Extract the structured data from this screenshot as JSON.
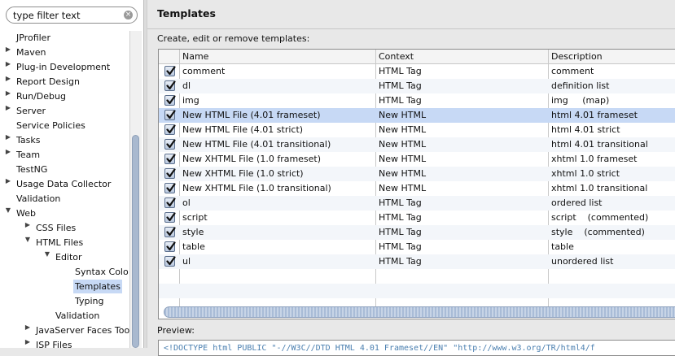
{
  "filter": {
    "placeholder": "type filter text"
  },
  "tree": [
    {
      "label": "JProfiler",
      "arrow": ""
    },
    {
      "label": "Maven",
      "arrow": "right"
    },
    {
      "label": "Plug-in Development",
      "arrow": "right"
    },
    {
      "label": "Report Design",
      "arrow": "right"
    },
    {
      "label": "Run/Debug",
      "arrow": "right"
    },
    {
      "label": "Server",
      "arrow": "right"
    },
    {
      "label": "Service Policies",
      "arrow": ""
    },
    {
      "label": "Tasks",
      "arrow": "right"
    },
    {
      "label": "Team",
      "arrow": "right"
    },
    {
      "label": "TestNG",
      "arrow": ""
    },
    {
      "label": "Usage Data Collector",
      "arrow": "right"
    },
    {
      "label": "Validation",
      "arrow": ""
    },
    {
      "label": "Web",
      "arrow": "down"
    },
    {
      "label": "CSS Files",
      "arrow": "right"
    },
    {
      "label": "HTML Files",
      "arrow": "down"
    },
    {
      "label": "Editor",
      "arrow": "down"
    },
    {
      "label": "Syntax Colo",
      "arrow": ""
    },
    {
      "label": "Templates",
      "arrow": "",
      "selected": true
    },
    {
      "label": "Typing",
      "arrow": ""
    },
    {
      "label": "Validation",
      "arrow": ""
    },
    {
      "label": "JavaServer Faces Too",
      "arrow": "right"
    },
    {
      "label": "JSP Files",
      "arrow": "right"
    }
  ],
  "page": {
    "title": "Templates",
    "instructions": "Create, edit or remove templates:",
    "preview_label": "Preview:",
    "preview_text": "<!DOCTYPE html PUBLIC \"-//W3C//DTD HTML 4.01 Frameset//EN\" \"http://www.w3.org/TR/html4/f"
  },
  "table": {
    "columns": [
      "Name",
      "Context",
      "Description"
    ],
    "rows": [
      {
        "name": "comment",
        "context": "HTML Tag",
        "description": "comment",
        "checked": true
      },
      {
        "name": "dl",
        "context": "HTML Tag",
        "description": "definition list",
        "checked": true
      },
      {
        "name": "img",
        "context": "HTML Tag",
        "description": "img     (map)",
        "checked": true
      },
      {
        "name": "New HTML File (4.01 frameset)",
        "context": "New HTML",
        "description": "html 4.01 frameset",
        "checked": true,
        "selected": true
      },
      {
        "name": "New HTML File (4.01 strict)",
        "context": "New HTML",
        "description": "html 4.01 strict",
        "checked": true
      },
      {
        "name": "New HTML File (4.01 transitional)",
        "context": "New HTML",
        "description": "html 4.01 transitional",
        "checked": true
      },
      {
        "name": "New XHTML File (1.0 frameset)",
        "context": "New HTML",
        "description": "xhtml 1.0 frameset",
        "checked": true
      },
      {
        "name": "New XHTML File (1.0 strict)",
        "context": "New HTML",
        "description": "xhtml 1.0 strict",
        "checked": true
      },
      {
        "name": "New XHTML File (1.0 transitional)",
        "context": "New HTML",
        "description": "xhtml 1.0 transitional",
        "checked": true
      },
      {
        "name": "ol",
        "context": "HTML Tag",
        "description": "ordered list",
        "checked": true
      },
      {
        "name": "script",
        "context": "HTML Tag",
        "description": "script    (commented)",
        "checked": true
      },
      {
        "name": "style",
        "context": "HTML Tag",
        "description": "style    (commented)",
        "checked": true
      },
      {
        "name": "table",
        "context": "HTML Tag",
        "description": "table",
        "checked": true
      },
      {
        "name": "ul",
        "context": "HTML Tag",
        "description": "unordered list",
        "checked": true
      }
    ]
  },
  "colors": {
    "selection": "#c7d9f5",
    "scrollbar": "#a9b9cf"
  },
  "icons": {
    "clear": "clear-search-icon",
    "check": "check-icon",
    "expand": "triangle-right-icon",
    "collapse": "triangle-down-icon"
  }
}
